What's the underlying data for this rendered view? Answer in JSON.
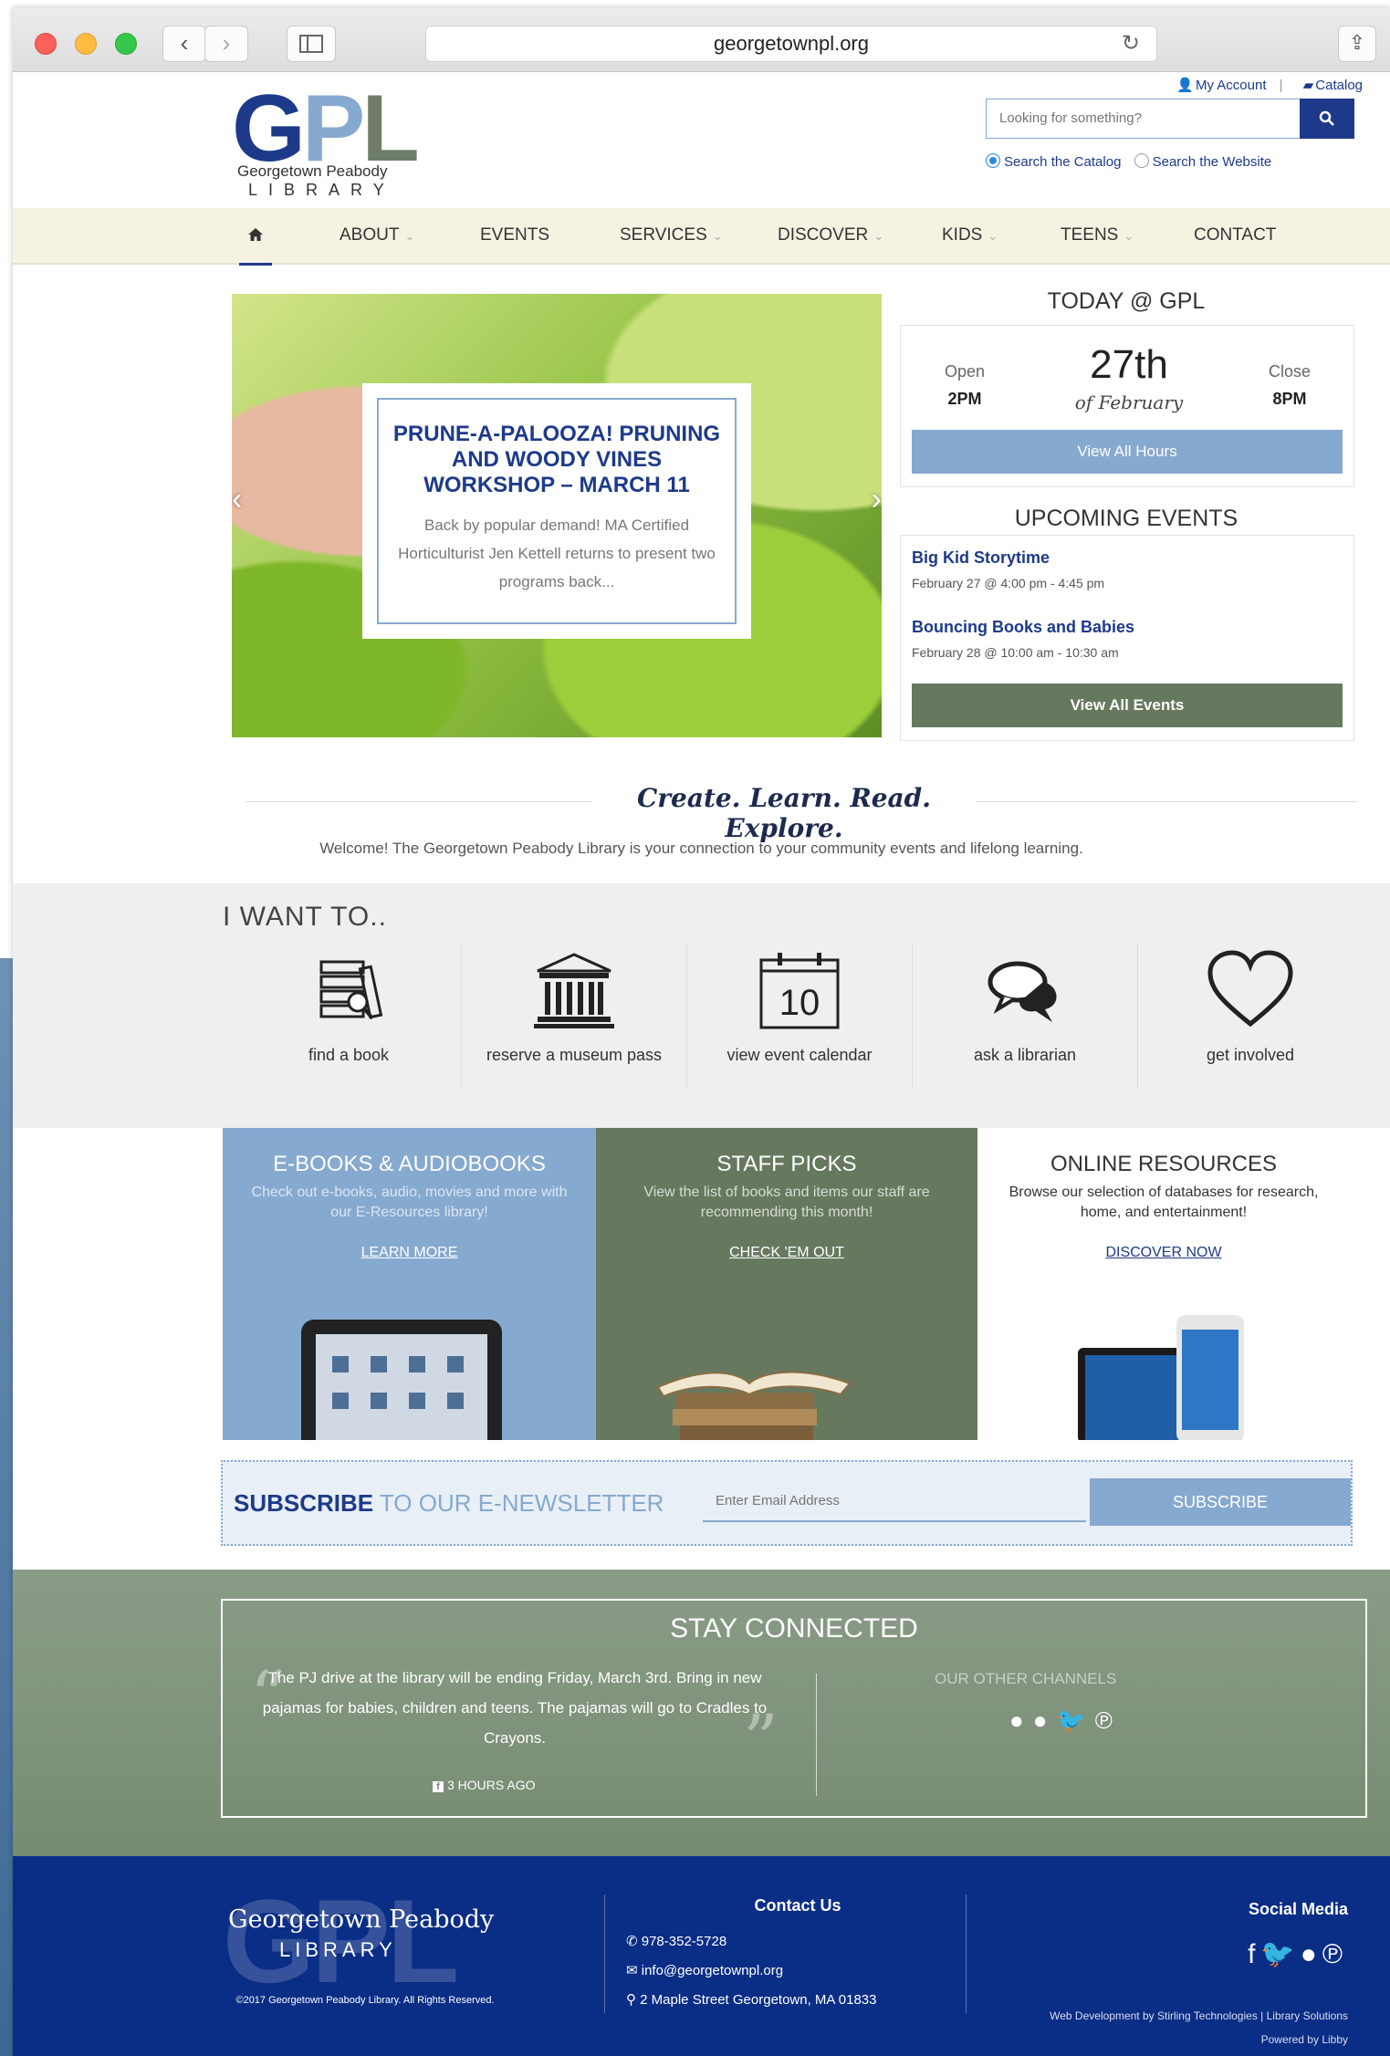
{
  "browser": {
    "url": "georgetownpl.org"
  },
  "header": {
    "logo_letters": [
      "G",
      "P",
      "L"
    ],
    "logo_sub": "Georgetown Peabody",
    "logo_lib": "LIBRARY",
    "my_account": "My Account",
    "catalog": "Catalog",
    "search_placeholder": "Looking for something?",
    "radio_catalog": "Search the Catalog",
    "radio_website": "Search the Website"
  },
  "nav": {
    "items": [
      "ABOUT",
      "EVENTS",
      "SERVICES",
      "DISCOVER",
      "KIDS",
      "TEENS",
      "CONTACT"
    ]
  },
  "slider": {
    "title": "PRUNE-A-PALOOZA! PRUNING AND WOODY VINES WORKSHOP – MARCH 11",
    "text": "Back by popular demand! MA Certified Horticulturist Jen Kettell returns to present two programs back..."
  },
  "today": {
    "heading": "TODAY @ GPL",
    "open_label": "Open",
    "open_time": "2PM",
    "close_label": "Close",
    "close_time": "8PM",
    "date": "27th",
    "month": "of February",
    "hours_button": "View All Hours"
  },
  "events": {
    "heading": "UPCOMING EVENTS",
    "items": [
      {
        "name": "Big Kid Storytime",
        "date": "February 27 @ 4:00 pm - 4:45 pm"
      },
      {
        "name": "Bouncing Books and Babies",
        "date": "February 28 @ 10:00 am - 10:30 am"
      }
    ],
    "button": "View All Events"
  },
  "tagline": {
    "script": "Create. Learn. Read. Explore.",
    "welcome": "Welcome! The Georgetown Peabody Library is your connection to your community events and lifelong learning."
  },
  "want": {
    "heading": "I WANT TO..",
    "tiles": [
      "find a book",
      "reserve a museum pass",
      "view event calendar",
      "ask a librarian",
      "get involved"
    ],
    "calendar_number": "10"
  },
  "promos": [
    {
      "title": "E-BOOKS & AUDIOBOOKS",
      "text": "Check out e-books, audio, movies and more with our E-Resources library!",
      "link": "LEARN MORE"
    },
    {
      "title": "STAFF PICKS",
      "text": "View the list of books and items our staff are recommending this month!",
      "link": "CHECK 'EM OUT"
    },
    {
      "title": "ONLINE RESOURCES",
      "text": "Browse our selection of databases for research, home, and entertainment!",
      "link": "DISCOVER NOW"
    }
  ],
  "subscribe": {
    "title_bold": "SUBSCRIBE",
    "title_rest": " TO OUR E-NEWSLETTER",
    "placeholder": "Enter Email Address",
    "button": "SUBSCRIBE"
  },
  "stay": {
    "heading": "STAY CONNECTED",
    "quote": "The PJ drive at the library will be ending Friday, March 3rd. Bring in new pajamas for babies, children and teens. The pajamas will go to Cradles to Crayons.",
    "ago": "3 HOURS AGO",
    "channels": "OUR OTHER CHANNELS"
  },
  "footer": {
    "logo_bg": "GPL",
    "name": "Georgetown Peabody",
    "lib": "LIBRARY",
    "copyright": "©2017 Georgetown Peabody Library. All Rights Reserved.",
    "contact_heading": "Contact Us",
    "phone": "978-352-5728",
    "email": "info@georgetownpl.org",
    "address": "2 Maple Street Georgetown, MA 01833",
    "social_heading": "Social Media",
    "credit_1": "Web Development by Stirling Technologies | Library Solutions",
    "credit_2": "Powered by Libby"
  },
  "colors": {
    "navy": "#1d3a8a",
    "light_blue": "#86a9cf",
    "sage": "#66795f",
    "footer": "#0a2d86",
    "nav_bg": "#f6f2e2"
  },
  "icons": [
    "home-icon",
    "book-search-icon",
    "museum-icon",
    "calendar-icon",
    "chat-bubbles-icon",
    "heart-icon",
    "flickr-icon",
    "twitter-icon",
    "pinterest-icon",
    "facebook-icon",
    "phone-icon",
    "mail-icon",
    "map-pin-icon",
    "search-icon",
    "user-icon",
    "book-icon",
    "reload-icon",
    "share-icon"
  ]
}
